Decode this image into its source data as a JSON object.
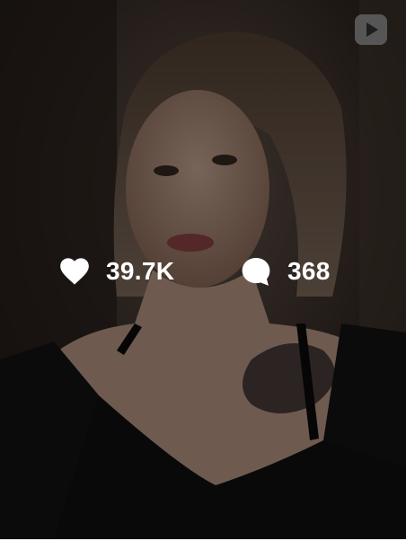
{
  "post": {
    "media_type_icon": "reel-play-icon",
    "likes_icon": "heart-icon",
    "likes_count": "39.7K",
    "comments_icon": "comment-bubble-icon",
    "comments_count": "368",
    "overlay_color": "#000000",
    "stat_text_color": "#ffffff"
  }
}
